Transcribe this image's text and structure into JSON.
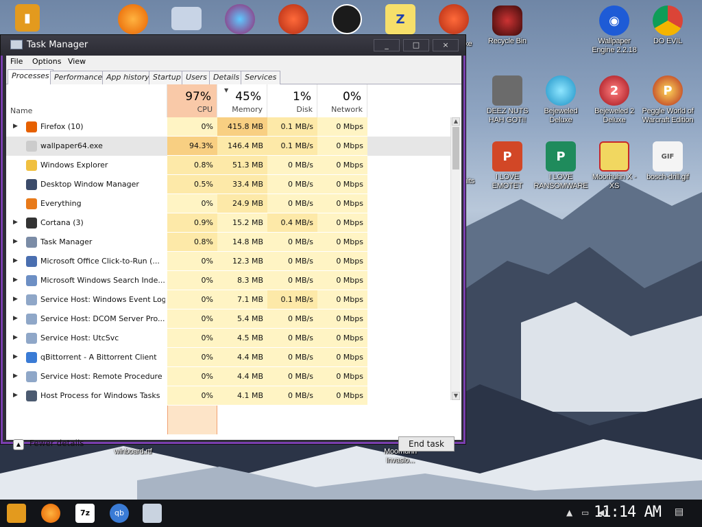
{
  "desktop": {
    "icons": [
      {
        "label": "exe",
        "color": "#b43f3f"
      },
      {
        "label": "Recycle Bin",
        "color": "#8a2323"
      },
      {
        "label": "Wallpaper Engine 2.2.18",
        "color": "#1e5bd6"
      },
      {
        "label": "DO EVIL",
        "color": "#d8d8d8"
      },
      {
        "label": "DEEZ NUTS HAH GOT!!",
        "color": "#5b5b5b"
      },
      {
        "label": "Bejeweled Deluxe",
        "color": "#2ea7d8"
      },
      {
        "label": "Bejeweled 2 Deluxe",
        "color": "#c8262c"
      },
      {
        "label": "Peggle World of Warcraft Edition",
        "color": "#e1a41a"
      },
      {
        "label": "I LOVE EMOTET",
        "color": "#d24726"
      },
      {
        "label": "I LOVE RANSOMWARE",
        "color": "#1f8b5c"
      },
      {
        "label": "Moorhuhn X - XS",
        "color": "#d9b93a"
      },
      {
        "label": "bosch-drill.gif",
        "color": "#eaeaea"
      },
      {
        "label": "hits",
        "color": "#3a5f9a"
      },
      {
        "label": "winboard.rtf",
        "color": "#3a5f9a"
      },
      {
        "label": "Moorhuhn Invasio...",
        "color": "#3a5f9a"
      }
    ]
  },
  "window": {
    "title": "Task Manager",
    "buttons": {
      "minimize": "_",
      "maximize": "□",
      "close": "×"
    }
  },
  "menu": [
    "File",
    "Options",
    "View"
  ],
  "tabs": [
    "Processes",
    "Performance",
    "App history",
    "Startup",
    "Users",
    "Details",
    "Services"
  ],
  "columns": {
    "name": "Name",
    "cpu": {
      "pct": "97%",
      "label": "CPU"
    },
    "memory": {
      "pct": "45%",
      "label": "Memory"
    },
    "disk": {
      "pct": "1%",
      "label": "Disk"
    },
    "network": {
      "pct": "0%",
      "label": "Network"
    }
  },
  "processes": [
    {
      "name": "Firefox (10)",
      "expandable": true,
      "cpu": "0%",
      "memory": "415.8 MB",
      "disk": "0.1 MB/s",
      "network": "0 Mbps",
      "icon": "#e66000"
    },
    {
      "name": "wallpaper64.exe",
      "expandable": false,
      "cpu": "94.3%",
      "memory": "146.4 MB",
      "disk": "0.1 MB/s",
      "network": "0 Mbps",
      "icon": "#cccccc"
    },
    {
      "name": "Windows Explorer",
      "expandable": false,
      "cpu": "0.8%",
      "memory": "51.3 MB",
      "disk": "0 MB/s",
      "network": "0 Mbps",
      "icon": "#f0c040"
    },
    {
      "name": "Desktop Window Manager",
      "expandable": false,
      "cpu": "0.5%",
      "memory": "33.4 MB",
      "disk": "0 MB/s",
      "network": "0 Mbps",
      "icon": "#3b4b6a"
    },
    {
      "name": "Everything",
      "expandable": false,
      "cpu": "0%",
      "memory": "24.9 MB",
      "disk": "0 MB/s",
      "network": "0 Mbps",
      "icon": "#e87a1a"
    },
    {
      "name": "Cortana (3)",
      "expandable": true,
      "cpu": "0.9%",
      "memory": "15.2 MB",
      "disk": "0.4 MB/s",
      "network": "0 Mbps",
      "icon": "#333333"
    },
    {
      "name": "Task Manager",
      "expandable": true,
      "cpu": "0.8%",
      "memory": "14.8 MB",
      "disk": "0 MB/s",
      "network": "0 Mbps",
      "icon": "#7b8ca6"
    },
    {
      "name": "Microsoft Office Click-to-Run (...",
      "expandable": true,
      "cpu": "0%",
      "memory": "12.3 MB",
      "disk": "0 MB/s",
      "network": "0 Mbps",
      "icon": "#4a6fb0"
    },
    {
      "name": "Microsoft Windows Search Inde...",
      "expandable": true,
      "cpu": "0%",
      "memory": "8.3 MB",
      "disk": "0 MB/s",
      "network": "0 Mbps",
      "icon": "#6d8fc4"
    },
    {
      "name": "Service Host: Windows Event Log",
      "expandable": true,
      "cpu": "0%",
      "memory": "7.1 MB",
      "disk": "0.1 MB/s",
      "network": "0 Mbps",
      "icon": "#8fa7c8"
    },
    {
      "name": "Service Host: DCOM Server Pro...",
      "expandable": true,
      "cpu": "0%",
      "memory": "5.4 MB",
      "disk": "0 MB/s",
      "network": "0 Mbps",
      "icon": "#8fa7c8"
    },
    {
      "name": "Service Host: UtcSvc",
      "expandable": true,
      "cpu": "0%",
      "memory": "4.5 MB",
      "disk": "0 MB/s",
      "network": "0 Mbps",
      "icon": "#8fa7c8"
    },
    {
      "name": "qBittorrent - A Bittorrent Client",
      "expandable": true,
      "cpu": "0%",
      "memory": "4.4 MB",
      "disk": "0 MB/s",
      "network": "0 Mbps",
      "icon": "#3a7bd5"
    },
    {
      "name": "Service Host: Remote Procedure ...",
      "expandable": true,
      "cpu": "0%",
      "memory": "4.4 MB",
      "disk": "0 MB/s",
      "network": "0 Mbps",
      "icon": "#8fa7c8"
    },
    {
      "name": "Host Process for Windows Tasks",
      "expandable": true,
      "cpu": "0%",
      "memory": "4.1 MB",
      "disk": "0 MB/s",
      "network": "0 Mbps",
      "icon": "#4b5a70"
    }
  ],
  "footer": {
    "fewer_details": "Fewer details",
    "end_task": "End task"
  },
  "taskbar": {
    "clock": "11:14 AM"
  },
  "colors": {
    "cpu_col": "#fde4c8",
    "cpu_head": "#f9c9a8",
    "heat_light": "#fff4c4",
    "heat_mid": "#fde9a8",
    "heat_hot": "#f8cf82",
    "window_accent": "#7a3fb0"
  }
}
